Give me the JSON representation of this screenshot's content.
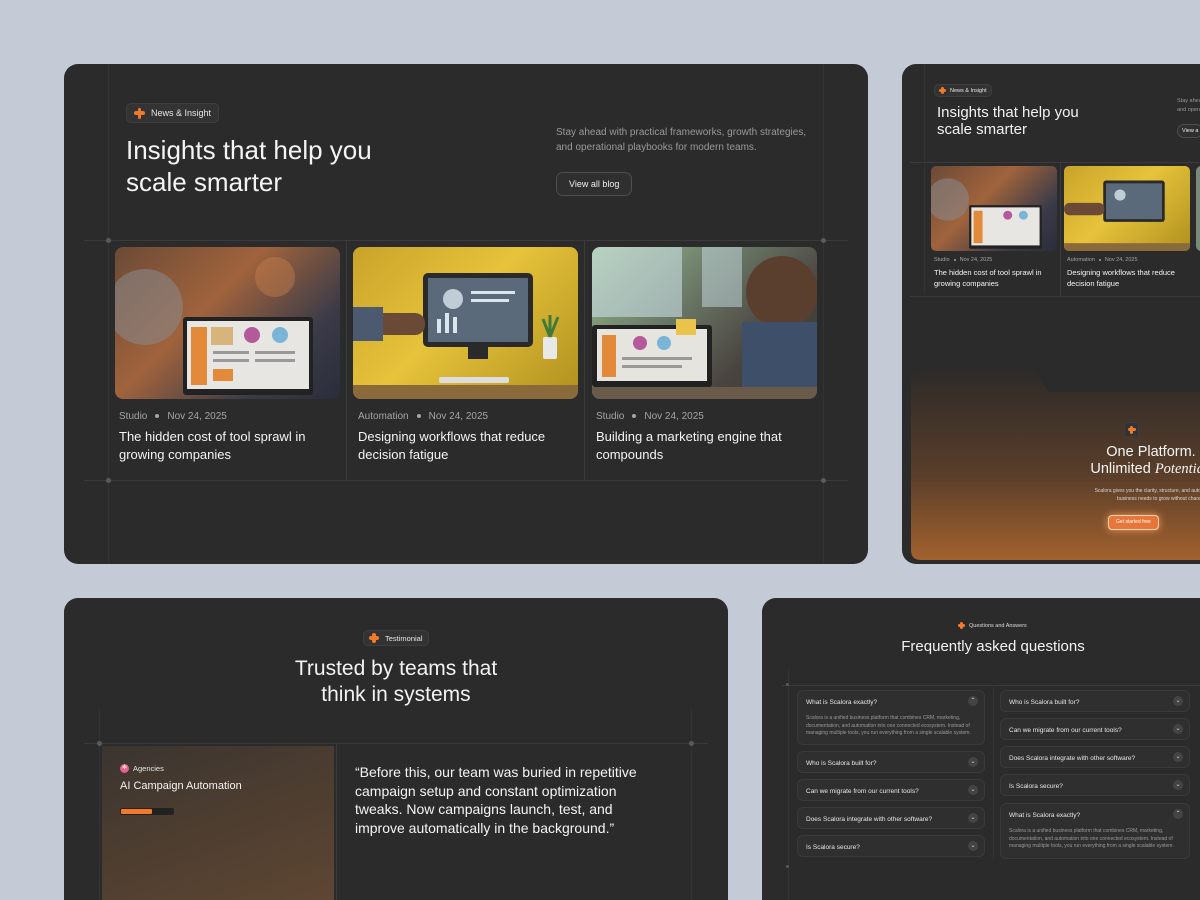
{
  "blog": {
    "badge": "News & Insight",
    "title_line1": "Insights that help you",
    "title_line2": "scale smarter",
    "description_line1": "Stay ahead with practical frameworks, growth strategies,",
    "description_line2": "and operational playbooks for modern teams.",
    "cta": "View all blog",
    "cards": [
      {
        "category": "Studio",
        "date": "Nov 24, 2025",
        "title_line1": "The hidden cost of tool sprawl in",
        "title_line2": "growing companies"
      },
      {
        "category": "Automation",
        "date": "Nov 24, 2025",
        "title_line1": "Designing workflows that reduce",
        "title_line2": "decision fatigue"
      },
      {
        "category": "Studio",
        "date": "Nov 24, 2025",
        "title_line1": "Building a marketing engine that",
        "title_line2": "compounds"
      }
    ]
  },
  "mini_blog": {
    "badge": "News & Insight",
    "title_line1": "Insights that help you",
    "title_line2": "scale smarter",
    "desc_snippet1": "Stay ahea",
    "desc_snippet2": "and opera",
    "cta_snippet": "View a",
    "cards": [
      {
        "category": "Studio",
        "date": "Nov 24, 2025",
        "title_line1": "The hidden cost of tool sprawl in",
        "title_line2": "growing companies"
      },
      {
        "category": "Automation",
        "date": "Nov 24, 2025",
        "title_line1": "Designing workflows that reduce",
        "title_line2": "decision fatigue"
      }
    ]
  },
  "cta_section": {
    "title_line1": "One Platform.",
    "title_line2_plain": "Unlimited ",
    "title_line2_italic": "Potential.",
    "desc_line1": "Scalora gives you the clarity, structure, and automation you",
    "desc_line2": "business needs to grow without chaos.",
    "button": "Get started free"
  },
  "testimonial": {
    "badge": "Testimonial",
    "title_line1": "Trusted by teams that",
    "title_line2": "think in systems",
    "tag": "Agencies",
    "case_title": "AI Campaign Automation",
    "progress": 0.6,
    "quote_line1": "“Before this, our team was buried in repetitive",
    "quote_line2": "campaign setup and constant optimization",
    "quote_line3": "tweaks. Now campaigns launch, test, and",
    "quote_line4": "improve automatically in the background.”"
  },
  "faq": {
    "badge": "Questions and Answers",
    "title": "Frequently asked questions",
    "left": [
      {
        "q": "What is Scalora exactly?",
        "open": true,
        "a_line1": "Scalora is a unified business platform that combines CRM, marketing,",
        "a_line2": "documentation, and automation into one connected ecosystem. Instead of",
        "a_line3": "managing multiple tools, you run everything from a single scalable system."
      },
      {
        "q": "Who is Scalora built for?",
        "open": false
      },
      {
        "q": "Can we migrate from our current tools?",
        "open": false
      },
      {
        "q": "Does Scalora integrate with other software?",
        "open": false
      },
      {
        "q": "Is Scalora secure?",
        "open": false
      }
    ],
    "right": [
      {
        "q": "Who is Scalora built for?",
        "open": false
      },
      {
        "q": "Can we migrate from our current tools?",
        "open": false
      },
      {
        "q": "Does Scalora integrate with other software?",
        "open": false
      },
      {
        "q": "Is Scalora secure?",
        "open": false
      },
      {
        "q": "What is Scalora exactly?",
        "open": true,
        "a_line1": "Scalora is a unified business platform that combines CRM, marketing,",
        "a_line2": "documentation, and automation into one connected ecosystem. Instead of",
        "a_line3": "managing multiple tools, you run everything from a single scalable system."
      }
    ]
  },
  "colors": {
    "background": "#c4cad6",
    "panel": "#2b2b2b",
    "accent": "#f07a2a"
  }
}
